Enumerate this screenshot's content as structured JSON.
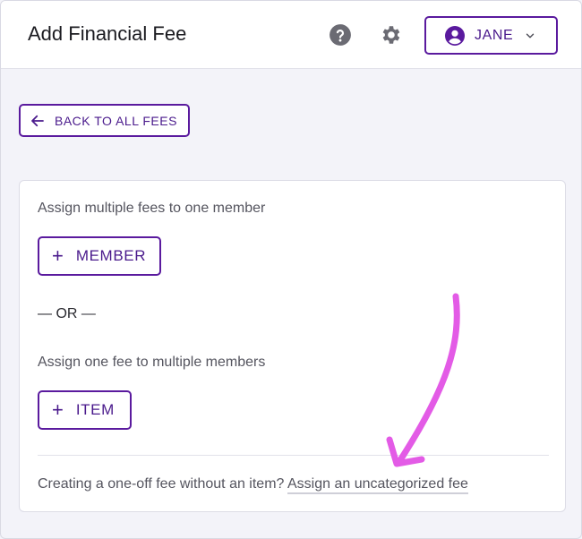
{
  "header": {
    "title": "Add Financial Fee",
    "help_icon": "help-circle-icon",
    "settings_icon": "gear-icon",
    "user": {
      "name": "JANE",
      "avatar_icon": "account-circle-icon",
      "chevron_icon": "chevron-down-icon"
    }
  },
  "back_button": {
    "label": "BACK TO ALL FEES",
    "icon": "arrow-left-icon"
  },
  "card": {
    "member_section": {
      "description": "Assign multiple fees to one member",
      "button_label": "MEMBER"
    },
    "separator": "— OR —",
    "item_section": {
      "description": "Assign one fee to multiple members",
      "button_label": "ITEM"
    },
    "footer": {
      "prompt": "Creating a one-off fee without an item?",
      "link_label": "Assign an uncategorized fee"
    }
  },
  "annotation": {
    "type": "hand-drawn-arrow",
    "color": "#e35be6"
  },
  "colors": {
    "accent": "#5a1a9e",
    "accent_text": "#4a1a8c",
    "background": "#f3f3f9",
    "muted_text": "#55555f"
  }
}
